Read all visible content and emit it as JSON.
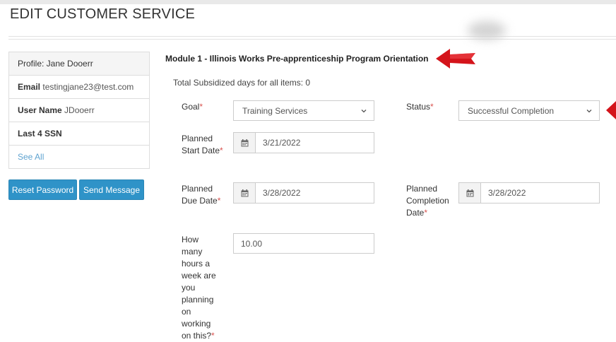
{
  "page": {
    "title": "EDIT CUSTOMER SERVICE"
  },
  "profile": {
    "header": "Profile: Jane Dooerr",
    "email_label": "Email",
    "email_value": "testingjane23@test.com",
    "username_label": "User Name",
    "username_value": "JDooerr",
    "ssn_label": "Last 4 SSN",
    "see_all": "See All"
  },
  "actions": {
    "reset_password": "Reset Password",
    "send_message": "Send Message"
  },
  "module": {
    "title": "Module 1 - Illinois Works Pre-apprenticeship Program Orientation",
    "subsidized": "Total Subsidized days for all items: 0"
  },
  "form": {
    "goal": {
      "label": "Goal",
      "required": "*",
      "value": "Training Services"
    },
    "status": {
      "label": "Status",
      "required": "*",
      "value": "Successful Completion"
    },
    "planned_start": {
      "label": "Planned Start Date",
      "required": "*",
      "value": "3/21/2022"
    },
    "planned_due": {
      "label": "Planned Due Date",
      "required": "*",
      "value": "3/28/2022"
    },
    "planned_completion": {
      "label": "Planned Completion Date",
      "required": "*",
      "value": "3/28/2022"
    },
    "hours": {
      "label": "How many hours a week are you planning on working on this?",
      "required": "*",
      "value": "10.00"
    }
  },
  "colors": {
    "button": "#2f93c8",
    "required": "#d9534f",
    "link": "#5fa3d0",
    "annotation_arrow": "#d4141b"
  },
  "icons": {
    "calendar": "calendar-icon",
    "dropdown": "chevron-down-icon",
    "annotation": "red-arrow-annotation"
  }
}
